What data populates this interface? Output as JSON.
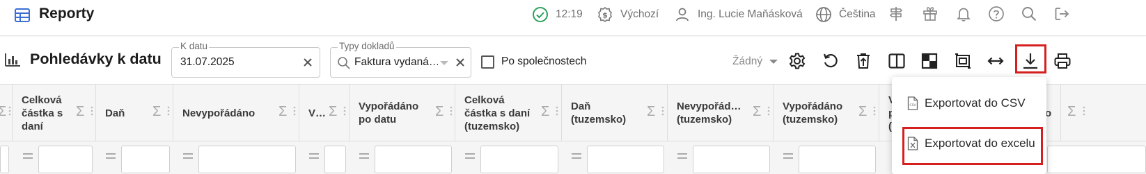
{
  "app": {
    "title": "Reporty"
  },
  "topbar": {
    "time": "12:19",
    "currency": "Výchozí",
    "user": "Ing. Lucie Maňásková",
    "language": "Čeština"
  },
  "report": {
    "title": "Pohledávky k datu",
    "date_field": {
      "label": "K datu",
      "value": "31.07.2025"
    },
    "doc_type_field": {
      "label": "Typy dokladů",
      "value": "Faktura vydaná…"
    },
    "by_company_label": "Po společnostech",
    "variant": "Žádný"
  },
  "columns": [
    {
      "label": "Celková\nčástka s\ndaní"
    },
    {
      "label": "Daň"
    },
    {
      "label": "Nevypořádáno"
    },
    {
      "label": "V…"
    },
    {
      "label": "Vypořádáno\npo datu"
    },
    {
      "label": "Celková\nčástka s daní\n(tuzemsko)"
    },
    {
      "label": "Daň\n(tuzemsko)"
    },
    {
      "label": "Nevypořád…\n(tuzemsko)"
    },
    {
      "label": "Vypořádáno\n(tuzemsko)"
    },
    {
      "label": "V\np\n("
    },
    {
      "label": "o"
    }
  ],
  "export_menu": {
    "csv": "Exportovat do CSV",
    "excel": "Exportovat do excelu"
  },
  "colors": {
    "accent": "#2f6fd8",
    "success": "#2aa15a",
    "highlight": "#d62020"
  }
}
